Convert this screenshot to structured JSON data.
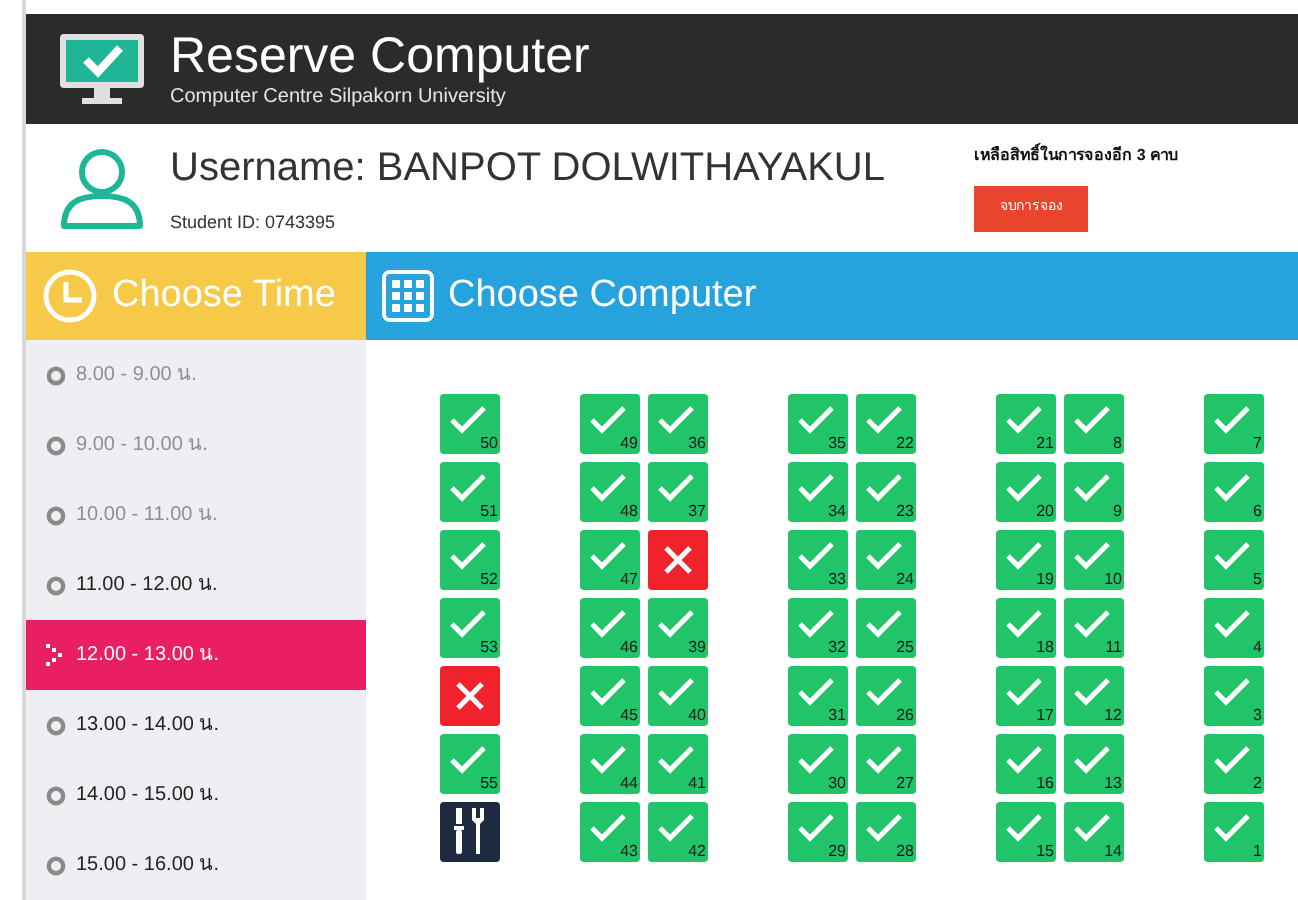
{
  "header": {
    "title": "Reserve Computer",
    "subtitle": "Computer Centre Silpakorn University"
  },
  "user": {
    "username": "Username: BANPOT DOLWITHAYAKUL",
    "student_id": "Student ID: 0743395",
    "quota": "เหลือสิทธิ์ในการจองอีก 3 คาบ",
    "finish_button": "จบการจอง"
  },
  "time_panel": {
    "title": "Choose Time",
    "slots": [
      {
        "label": "8.00 - 9.00 น.",
        "disabled": true,
        "selected": false
      },
      {
        "label": "9.00 - 10.00 น.",
        "disabled": true,
        "selected": false
      },
      {
        "label": "10.00 - 11.00 น.",
        "disabled": true,
        "selected": false
      },
      {
        "label": "11.00 - 12.00 น.",
        "disabled": false,
        "selected": false
      },
      {
        "label": "12.00 - 13.00 น.",
        "disabled": false,
        "selected": true
      },
      {
        "label": "13.00 - 14.00 น.",
        "disabled": false,
        "selected": false
      },
      {
        "label": "14.00 - 15.00 น.",
        "disabled": false,
        "selected": false
      },
      {
        "label": "15.00 - 16.00 น.",
        "disabled": false,
        "selected": false
      }
    ]
  },
  "computer_panel": {
    "title": "Choose Computer",
    "groups": [
      [
        [
          {
            "number": "50",
            "kind": "available"
          },
          {
            "number": "51",
            "kind": "available"
          },
          {
            "number": "52",
            "kind": "available"
          },
          {
            "number": "53",
            "kind": "available"
          },
          {
            "kind": "taken"
          },
          {
            "number": "55",
            "kind": "available"
          },
          {
            "kind": "maintenance"
          }
        ]
      ],
      [
        [
          {
            "number": "49",
            "kind": "available"
          },
          {
            "number": "48",
            "kind": "available"
          },
          {
            "number": "47",
            "kind": "available"
          },
          {
            "number": "46",
            "kind": "available"
          },
          {
            "number": "45",
            "kind": "available"
          },
          {
            "number": "44",
            "kind": "available"
          },
          {
            "number": "43",
            "kind": "available"
          }
        ],
        [
          {
            "number": "36",
            "kind": "available"
          },
          {
            "number": "37",
            "kind": "available"
          },
          {
            "kind": "taken"
          },
          {
            "number": "39",
            "kind": "available"
          },
          {
            "number": "40",
            "kind": "available"
          },
          {
            "number": "41",
            "kind": "available"
          },
          {
            "number": "42",
            "kind": "available"
          }
        ]
      ],
      [
        [
          {
            "number": "35",
            "kind": "available"
          },
          {
            "number": "34",
            "kind": "available"
          },
          {
            "number": "33",
            "kind": "available"
          },
          {
            "number": "32",
            "kind": "available"
          },
          {
            "number": "31",
            "kind": "available"
          },
          {
            "number": "30",
            "kind": "available"
          },
          {
            "number": "29",
            "kind": "available"
          }
        ],
        [
          {
            "number": "22",
            "kind": "available"
          },
          {
            "number": "23",
            "kind": "available"
          },
          {
            "number": "24",
            "kind": "available"
          },
          {
            "number": "25",
            "kind": "available"
          },
          {
            "number": "26",
            "kind": "available"
          },
          {
            "number": "27",
            "kind": "available"
          },
          {
            "number": "28",
            "kind": "available"
          }
        ]
      ],
      [
        [
          {
            "number": "21",
            "kind": "available"
          },
          {
            "number": "20",
            "kind": "available"
          },
          {
            "number": "19",
            "kind": "available"
          },
          {
            "number": "18",
            "kind": "available"
          },
          {
            "number": "17",
            "kind": "available"
          },
          {
            "number": "16",
            "kind": "available"
          },
          {
            "number": "15",
            "kind": "available"
          }
        ],
        [
          {
            "number": "8",
            "kind": "available"
          },
          {
            "number": "9",
            "kind": "available"
          },
          {
            "number": "10",
            "kind": "available"
          },
          {
            "number": "11",
            "kind": "available"
          },
          {
            "number": "12",
            "kind": "available"
          },
          {
            "number": "13",
            "kind": "available"
          },
          {
            "number": "14",
            "kind": "available"
          }
        ]
      ],
      [
        [
          {
            "number": "7",
            "kind": "available"
          },
          {
            "number": "6",
            "kind": "available"
          },
          {
            "number": "5",
            "kind": "available"
          },
          {
            "number": "4",
            "kind": "available"
          },
          {
            "number": "3",
            "kind": "available"
          },
          {
            "number": "2",
            "kind": "available"
          },
          {
            "number": "1",
            "kind": "available"
          }
        ]
      ]
    ]
  }
}
